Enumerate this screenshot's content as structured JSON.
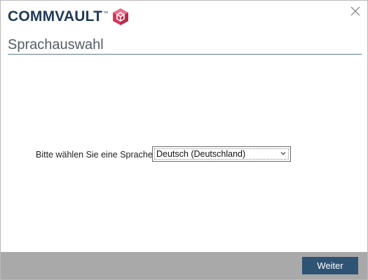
{
  "brand": {
    "name": "COMMVAULT",
    "trademark": "™",
    "logo_icon": "cube-icon",
    "colors": {
      "text": "#1f3a57",
      "cube": "#d6375a"
    }
  },
  "window": {
    "close_icon": "close-icon"
  },
  "page": {
    "title": "Sprachauswahl"
  },
  "language": {
    "label": "Bitte wählen Sie eine Sprache",
    "selected": "Deutsch (Deutschland)"
  },
  "footer": {
    "next_label": "Weiter",
    "button_color": "#2f5373",
    "background_color": "#a9a9a9"
  }
}
